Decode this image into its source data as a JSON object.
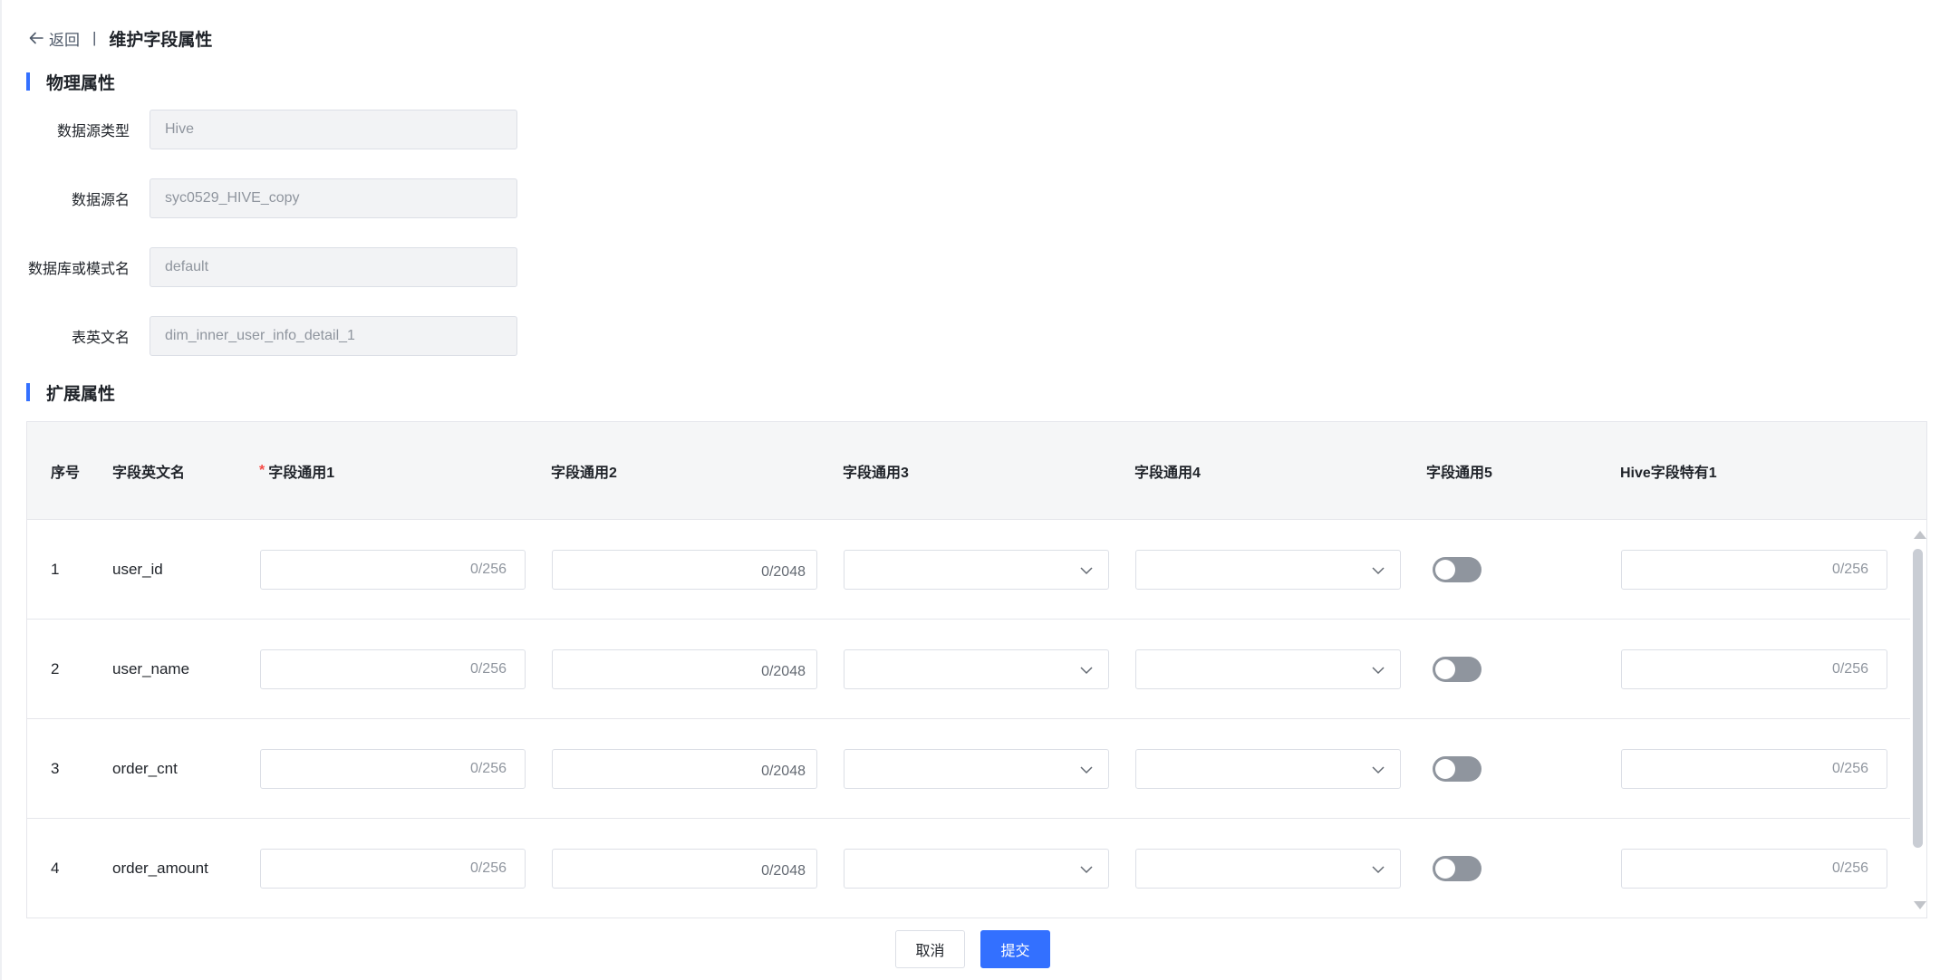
{
  "header": {
    "back_label": "返回",
    "separator": "|",
    "title": "维护字段属性"
  },
  "physical": {
    "section_title": "物理属性",
    "fields": [
      {
        "label": "数据源类型",
        "value": "Hive"
      },
      {
        "label": "数据源名",
        "value": "syc0529_HIVE_copy"
      },
      {
        "label": "数据库或模式名",
        "value": "default"
      },
      {
        "label": "表英文名",
        "value": "dim_inner_user_info_detail_1"
      }
    ]
  },
  "extended": {
    "section_title": "扩展属性",
    "columns": {
      "index": "序号",
      "field_name": "字段英文名",
      "general1_required_mark": "*",
      "general1": "字段通用1",
      "general2": "字段通用2",
      "general3": "字段通用3",
      "general4": "字段通用4",
      "general5": "字段通用5",
      "hive1": "Hive字段特有1"
    },
    "rows": [
      {
        "index": "1",
        "field_name": "user_id",
        "general1_count": "0/256",
        "general2_count": "0/2048",
        "general5_on": false,
        "hive1_count": "0/256"
      },
      {
        "index": "2",
        "field_name": "user_name",
        "general1_count": "0/256",
        "general2_count": "0/2048",
        "general5_on": false,
        "hive1_count": "0/256"
      },
      {
        "index": "3",
        "field_name": "order_cnt",
        "general1_count": "0/256",
        "general2_count": "0/2048",
        "general5_on": false,
        "hive1_count": "0/256"
      },
      {
        "index": "4",
        "field_name": "order_amount",
        "general1_count": "0/256",
        "general2_count": "0/2048",
        "general5_on": false,
        "hive1_count": "0/256"
      }
    ]
  },
  "footer": {
    "cancel_label": "取消",
    "submit_label": "提交"
  },
  "colors": {
    "accent": "#3370ff",
    "required": "#f54a45",
    "toggle_off": "#8f959e"
  }
}
